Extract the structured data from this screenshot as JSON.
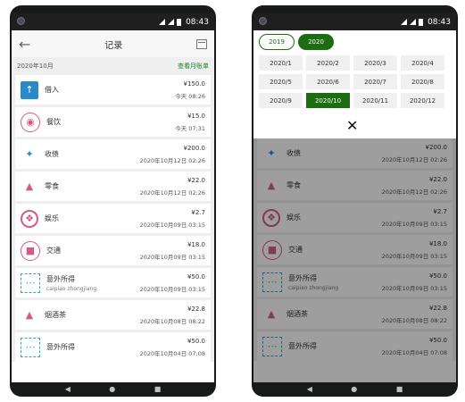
{
  "status": {
    "time": "08:43"
  },
  "header": {
    "title": "记录"
  },
  "month_bar": {
    "label": "2020年10月",
    "link": "查看月账单"
  },
  "entries": [
    {
      "name": "借入",
      "sub": "",
      "amount": "¥150.0",
      "time": "今天 08:26",
      "icon": "arrow-up-icon"
    },
    {
      "name": "餐饮",
      "sub": "",
      "amount": "¥15.0",
      "time": "今天 07:31",
      "icon": "dining-icon"
    },
    {
      "name": "收债",
      "sub": "",
      "amount": "¥200.0",
      "time": "2020年10月12日 02:26",
      "icon": "money-hand-icon"
    },
    {
      "name": "零食",
      "sub": "",
      "amount": "¥22.0",
      "time": "2020年10月12日 02:26",
      "icon": "snack-icon"
    },
    {
      "name": "娱乐",
      "sub": "",
      "amount": "¥2.7",
      "time": "2020年10月09日 03:15",
      "icon": "film-reel-icon"
    },
    {
      "name": "交通",
      "sub": "",
      "amount": "¥18.0",
      "time": "2020年10月09日 03:15",
      "icon": "bus-icon"
    },
    {
      "name": "意外所得",
      "sub": "caipiao zhongjiang",
      "amount": "¥50.0",
      "time": "2020年10月09日 03:15",
      "icon": "lottery-icon"
    },
    {
      "name": "烟酒茶",
      "sub": "",
      "amount": "¥22.8",
      "time": "2020年10月08日 08:22",
      "icon": "drink-icon"
    },
    {
      "name": "意外所得",
      "sub": "",
      "amount": "¥50.0",
      "time": "2020年10月04日 07:08",
      "icon": "lottery-icon"
    }
  ],
  "picker": {
    "years": [
      "2019",
      "2020"
    ],
    "selected_year": "2020",
    "months": [
      "2020/1",
      "2020/2",
      "2020/3",
      "2020/4",
      "2020/5",
      "2020/6",
      "2020/7",
      "2020/8",
      "2020/9",
      "2020/10",
      "2020/11",
      "2020/12"
    ],
    "selected_month": "2020/10",
    "close_icon": "close-icon"
  },
  "colors": {
    "accent": "#1b6d0f",
    "link": "#1b7d2f",
    "icon_blue": "#2a89c7",
    "icon_pink": "#d45b88"
  }
}
